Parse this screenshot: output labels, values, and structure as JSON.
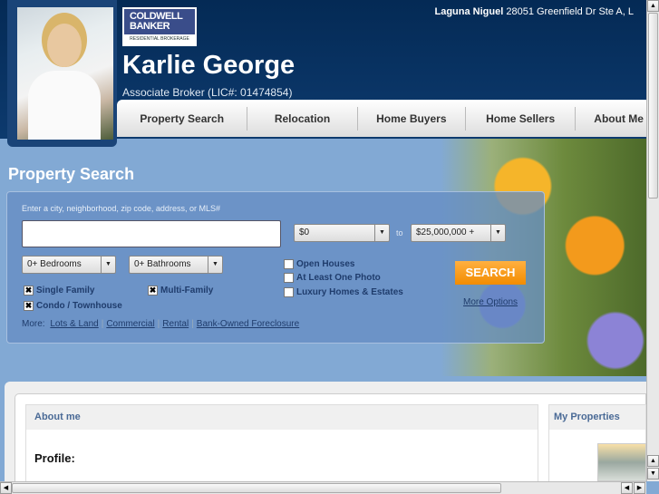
{
  "header": {
    "office": "Laguna Niguel",
    "address": "28051 Greenfield Dr Ste A, L",
    "name": "Karlie George",
    "title": "Associate Broker (LIC#: 01474854)",
    "logo": {
      "line1": "COLDWELL",
      "line2": "BANKER",
      "sub": "RESIDENTIAL BROKERAGE"
    }
  },
  "nav": [
    "Property Search",
    "Relocation",
    "Home Buyers",
    "Home Sellers",
    "About Me"
  ],
  "search": {
    "title": "Property Search",
    "hint": "Enter a city, neighborhood, zip code, address, or MLS#",
    "query": "",
    "min_price": "$0",
    "to": "to",
    "max_price": "$25,000,000 +",
    "bedrooms": "0+ Bedrooms",
    "bathrooms": "0+ Bathrooms",
    "types": [
      {
        "label": "Single Family",
        "checked": true
      },
      {
        "label": "Multi-Family",
        "checked": true
      },
      {
        "label": "Condo / Townhouse",
        "checked": true
      }
    ],
    "filters": [
      {
        "label": "Open Houses",
        "checked": false
      },
      {
        "label": "At Least One Photo",
        "checked": false
      },
      {
        "label": "Luxury Homes & Estates",
        "checked": false
      }
    ],
    "button": "SEARCH",
    "more_options": "More Options",
    "more_label": "More:",
    "more_links": [
      "Lots & Land",
      "Commercial",
      "Rental",
      "Bank-Owned Foreclosure"
    ]
  },
  "about": {
    "header": "About me",
    "profile": "Profile:"
  },
  "properties": {
    "header": "My Properties"
  },
  "icons": {
    "check": "✖",
    "down": "▼",
    "up": "▲",
    "left": "◀",
    "right": "▶"
  }
}
